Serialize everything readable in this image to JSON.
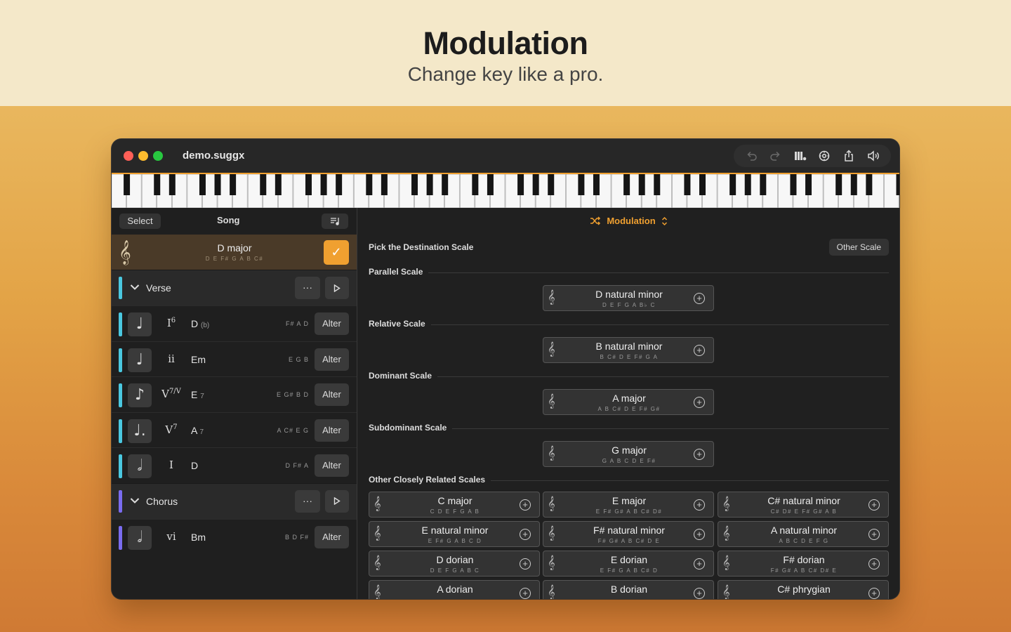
{
  "banner": {
    "title": "Modulation",
    "subtitle": "Change key like a pro."
  },
  "window": {
    "title": "demo.suggx"
  },
  "toolbar": {
    "icons": [
      "undo-icon",
      "redo-icon",
      "piano-settings-icon",
      "gear-icon",
      "share-icon",
      "speaker-icon"
    ]
  },
  "sidebar": {
    "select_label": "Select",
    "title": "Song",
    "key": {
      "name": "D major",
      "notes": "D E F# G A B C#"
    },
    "verse": {
      "name": "Verse",
      "color": "#4ac8e0"
    },
    "chorus": {
      "name": "Chorus",
      "color": "#7a6cf0"
    },
    "more_label": "···",
    "chords": [
      {
        "dur": "♩",
        "roman": "I",
        "sup": "6",
        "chord": "D",
        "suffix": "(b)",
        "notes": "F# A D",
        "alter": "Alter",
        "section": "verse"
      },
      {
        "dur": "♩",
        "roman": "ii",
        "sup": "",
        "chord": "Em",
        "suffix": "",
        "notes": "E G B",
        "alter": "Alter",
        "section": "verse"
      },
      {
        "dur": "♪",
        "roman": "V",
        "sup": "7/V",
        "chord": "E",
        "suffix": "7",
        "notes": "E G# B D",
        "alter": "Alter",
        "section": "verse"
      },
      {
        "dur": "♩.",
        "roman": "V",
        "sup": "7",
        "chord": "A",
        "suffix": "7",
        "notes": "A C# E G",
        "alter": "Alter",
        "section": "verse"
      },
      {
        "dur": "𝅗𝅥",
        "roman": "I",
        "sup": "",
        "chord": "D",
        "suffix": "",
        "notes": "D F# A",
        "alter": "Alter",
        "section": "verse"
      },
      {
        "dur": "𝅗𝅥",
        "roman": "vi",
        "sup": "",
        "chord": "Bm",
        "suffix": "",
        "notes": "B D F#",
        "alter": "Alter",
        "section": "chorus"
      }
    ]
  },
  "main": {
    "mode_title": "Modulation",
    "pick_label": "Pick the Destination Scale",
    "other_scale": "Other Scale",
    "categories": {
      "parallel": {
        "label": "Parallel Scale",
        "scale": {
          "name": "D natural minor",
          "notes": "D E F G A B♭ C"
        }
      },
      "relative": {
        "label": "Relative Scale",
        "scale": {
          "name": "B natural minor",
          "notes": "B C# D E F# G A"
        }
      },
      "dominant": {
        "label": "Dominant Scale",
        "scale": {
          "name": "A major",
          "notes": "A B C# D E F# G#"
        }
      },
      "subdominant": {
        "label": "Subdominant Scale",
        "scale": {
          "name": "G major",
          "notes": "G A B C D E F#"
        }
      },
      "other": {
        "label": "Other Closely Related Scales"
      }
    },
    "related": [
      {
        "name": "C major",
        "notes": "C D E F G A B"
      },
      {
        "name": "E major",
        "notes": "E F# G# A B C# D#"
      },
      {
        "name": "C# natural minor",
        "notes": "C# D# E F# G# A B"
      },
      {
        "name": "E natural minor",
        "notes": "E F# G A B C D"
      },
      {
        "name": "F# natural minor",
        "notes": "F# G# A B C# D E"
      },
      {
        "name": "A natural minor",
        "notes": "A B C D E F G"
      },
      {
        "name": "D dorian",
        "notes": "D E F G A B C"
      },
      {
        "name": "E dorian",
        "notes": "E F# G A B C# D"
      },
      {
        "name": "F# dorian",
        "notes": "F# G# A B C# D# E"
      },
      {
        "name": "A dorian",
        "notes": ""
      },
      {
        "name": "B dorian",
        "notes": ""
      },
      {
        "name": "C# phrygian",
        "notes": ""
      }
    ]
  }
}
